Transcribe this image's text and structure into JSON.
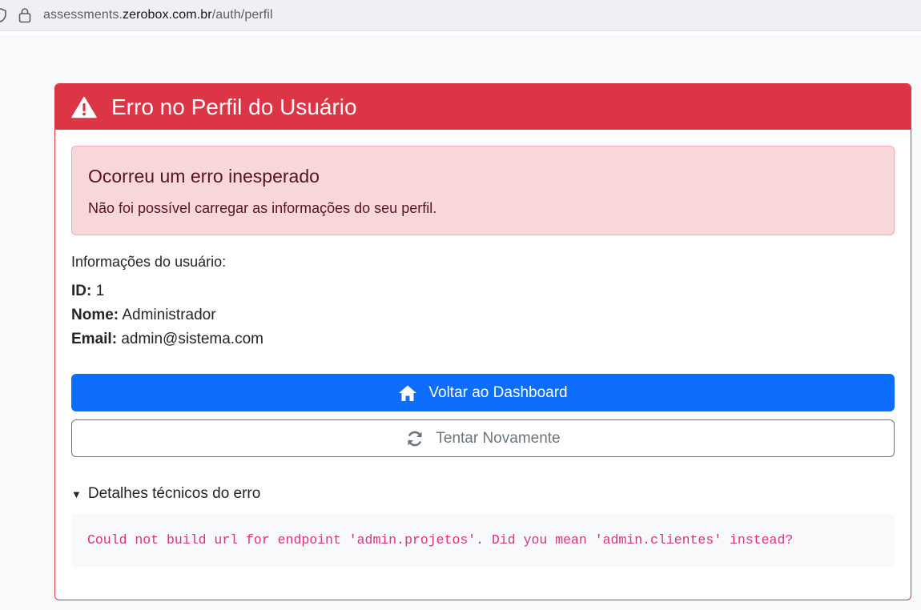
{
  "browser": {
    "url_prefix": "assessments.",
    "url_host": "zerobox.com.br",
    "url_path": "/auth/perfil"
  },
  "card": {
    "title": "Erro no Perfil do Usuário",
    "header_icon": "warning-triangle-icon",
    "alert": {
      "heading": "Ocorreu um erro inesperado",
      "message": "Não foi possível carregar as informações do seu perfil."
    },
    "user_info": {
      "intro": "Informações do usuário:",
      "id_label": "ID:",
      "id_value": "1",
      "name_label": "Nome:",
      "name_value": "Administrador",
      "email_label": "Email:",
      "email_value": "admin@sistema.com"
    },
    "buttons": {
      "dashboard_label": "Voltar ao Dashboard",
      "dashboard_icon": "home-icon",
      "retry_label": "Tentar Novamente",
      "retry_icon": "refresh-icon"
    },
    "details": {
      "summary": "Detalhes técnicos do erro",
      "error_text": "Could not build url for endpoint 'admin.projetos'. Did you mean 'admin.clientes' instead?"
    }
  },
  "colors": {
    "danger": "#dc3545",
    "primary": "#0d6efd",
    "secondary": "#6c757d",
    "code": "#d63384"
  }
}
